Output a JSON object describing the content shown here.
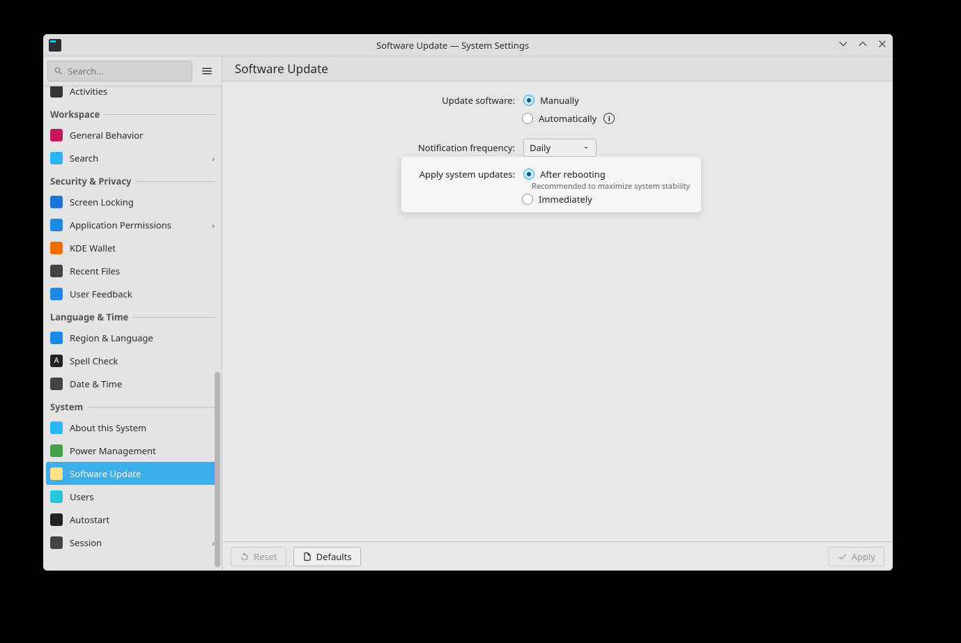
{
  "window": {
    "title": "Software Update — System Settings"
  },
  "search": {
    "placeholder": "Search..."
  },
  "sidebar": {
    "top_cut_item": "Activities",
    "groups": [
      {
        "name": "Workspace",
        "items": [
          {
            "label": "General Behavior",
            "icon_bg": "#c2185b"
          },
          {
            "label": "Search",
            "icon_bg": "#29b6f6",
            "has_sub": true
          }
        ]
      },
      {
        "name": "Security & Privacy",
        "items": [
          {
            "label": "Screen Locking",
            "icon_bg": "#1976d2"
          },
          {
            "label": "Application Permissions",
            "icon_bg": "#1e88e5",
            "has_sub": true
          },
          {
            "label": "KDE Wallet",
            "icon_bg": "#ef6c00"
          },
          {
            "label": "Recent Files",
            "icon_bg": "#424242"
          },
          {
            "label": "User Feedback",
            "icon_bg": "#1e88e5"
          }
        ]
      },
      {
        "name": "Language & Time",
        "items": [
          {
            "label": "Region & Language",
            "icon_bg": "#1e88e5"
          },
          {
            "label": "Spell Check",
            "icon_bg": "#222",
            "icon_text": "A"
          },
          {
            "label": "Date & Time",
            "icon_bg": "#424242"
          }
        ]
      },
      {
        "name": "System",
        "items": [
          {
            "label": "About this System",
            "icon_bg": "#29b6f6"
          },
          {
            "label": "Power Management",
            "icon_bg": "#43a047"
          },
          {
            "label": "Software Update",
            "icon_bg": "#ffe082",
            "selected": true
          },
          {
            "label": "Users",
            "icon_bg": "#26c6da"
          },
          {
            "label": "Autostart",
            "icon_bg": "#222"
          },
          {
            "label": "Session",
            "icon_bg": "#424242",
            "has_sub": true
          }
        ]
      }
    ]
  },
  "page": {
    "title": "Software Update",
    "update_software_label": "Update software:",
    "update_software_options": {
      "manually": "Manually",
      "automatically": "Automatically"
    },
    "update_software_selected": "manually",
    "notification_label": "Notification frequency:",
    "notification_value": "Daily",
    "apply_label": "Apply system updates:",
    "apply_options": {
      "after_reboot": "After rebooting",
      "immediately": "Immediately"
    },
    "apply_selected": "after_reboot",
    "apply_hint": "Recommended to maximize system stability"
  },
  "footer": {
    "reset": "Reset",
    "defaults": "Defaults",
    "apply": "Apply"
  }
}
